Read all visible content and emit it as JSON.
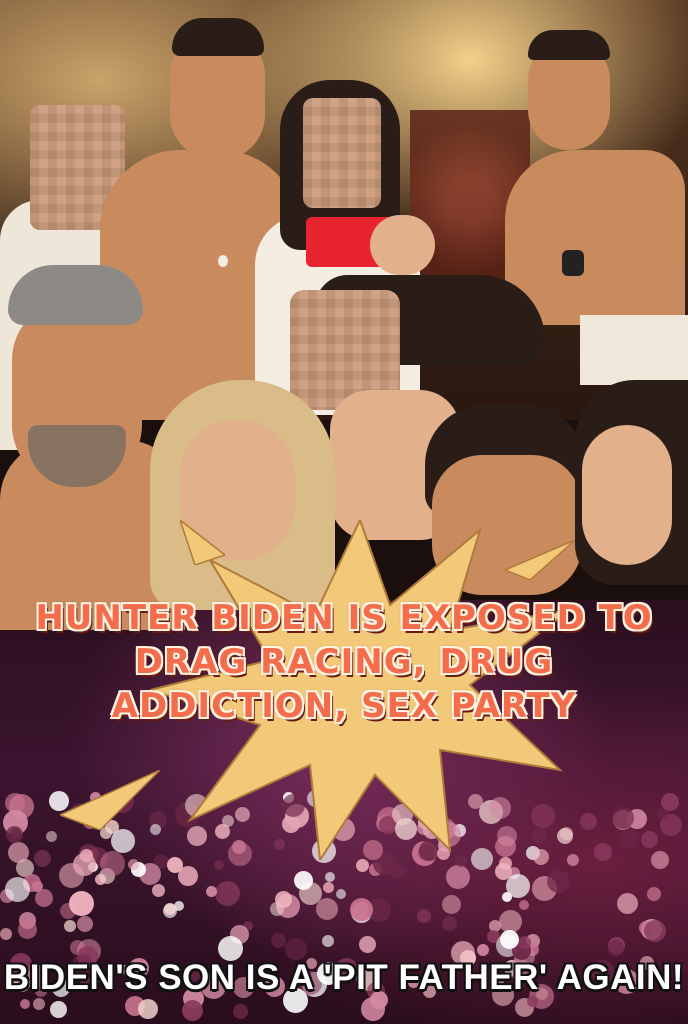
{
  "poster": {
    "headline": "HUNTER BIDEN IS EXPOSED TO DRAG RACING, DRUG ADDICTION, SEX PARTY",
    "subheadline": "BIDEN'S SON IS A 'PIT FATHER' AGAIN!"
  },
  "colors": {
    "headline_fill": "#f36d4d",
    "headline_outline": "#fff3e2",
    "burst_fill": "#f2c879",
    "subheadline_fill": "#ffffff"
  }
}
